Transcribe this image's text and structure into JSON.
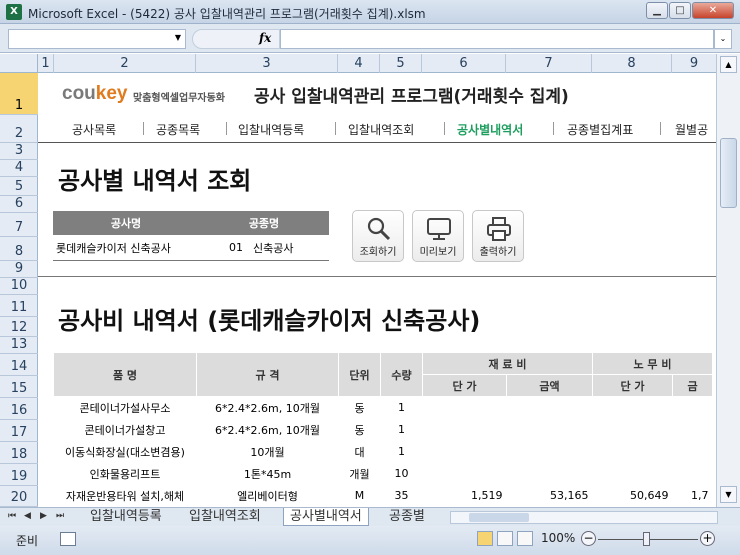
{
  "window": {
    "title": "Microsoft Excel - (5422) 공사 입찰내역관리 프로그램(거래횟수 집계).xlsm",
    "app_icon": "excel-icon"
  },
  "formula": {
    "fx_label": "fx"
  },
  "columns": [
    "1",
    "2",
    "3",
    "4",
    "5",
    "6",
    "7",
    "8",
    "9"
  ],
  "rows": [
    "1",
    "2",
    "3",
    "4",
    "5",
    "6",
    "7",
    "8",
    "9",
    "10",
    "11",
    "12",
    "13",
    "14",
    "15",
    "16",
    "17",
    "18",
    "19",
    "20"
  ],
  "header": {
    "logo_co": "cou",
    "logo_key": "key",
    "tagline": "맞춤형엑셀업무자동화",
    "title": "공사 입찰내역관리 프로그램(거래횟수 집계)"
  },
  "nav": {
    "items": [
      {
        "label": "공사목록"
      },
      {
        "label": "공종목록"
      },
      {
        "label": "입찰내역등록"
      },
      {
        "label": "입찰내역조회"
      },
      {
        "label": "공사별내역서",
        "active": true
      },
      {
        "label": "공종별집계표"
      },
      {
        "label": "월별공"
      }
    ]
  },
  "section1": {
    "title": "공사별 내역서 조회"
  },
  "info": {
    "headers": [
      "공사명",
      "공종명"
    ],
    "project": "롯데캐슬카이저 신축공사",
    "code": "01",
    "category": "신축공사"
  },
  "buttons": {
    "search": "조회하기",
    "preview": "미리보기",
    "print": "출력하기"
  },
  "section2": {
    "title": "공사비 내역서 (롯데캐슬카이저 신축공사)"
  },
  "table": {
    "headers": {
      "name": "품 명",
      "spec": "규 격",
      "unit": "단위",
      "qty": "수량",
      "material": "재 료 비",
      "labor": "노 무 비",
      "unit_price": "단 가",
      "amount": "금액",
      "labor_unit_price": "단 가",
      "labor_amount": "금"
    },
    "rows": [
      {
        "name": "콘테이너가설사무소",
        "spec": "6*2.4*2.6m, 10개월",
        "unit": "동",
        "qty": "1",
        "m_price": "",
        "m_amount": "",
        "l_price": "",
        "l_amount": ""
      },
      {
        "name": "콘테이너가설창고",
        "spec": "6*2.4*2.6m, 10개월",
        "unit": "동",
        "qty": "1",
        "m_price": "",
        "m_amount": "",
        "l_price": "",
        "l_amount": ""
      },
      {
        "name": "이동식화장실(대소변겸용)",
        "spec": "10개월",
        "unit": "대",
        "qty": "1",
        "m_price": "",
        "m_amount": "",
        "l_price": "",
        "l_amount": ""
      },
      {
        "name": "인화물용리프트",
        "spec": "1톤*45m",
        "unit": "개월",
        "qty": "10",
        "m_price": "",
        "m_amount": "",
        "l_price": "",
        "l_amount": ""
      },
      {
        "name": "자재운반용타워 설치,해체",
        "spec": "엘리베이터형",
        "unit": "M",
        "qty": "35",
        "m_price": "1,519",
        "m_amount": "53,165",
        "l_price": "50,649",
        "l_amount": "1,7"
      }
    ]
  },
  "sheets": {
    "tabs": [
      "입찰내역등록",
      "입찰내역조회",
      "공사별내역서",
      "공종별"
    ],
    "active": 2
  },
  "status": {
    "ready": "준비",
    "zoom": "100%"
  },
  "colors": {
    "accent": "#1d9e5e",
    "selected": "#f6d472",
    "logo_key": "#e07b1e"
  }
}
